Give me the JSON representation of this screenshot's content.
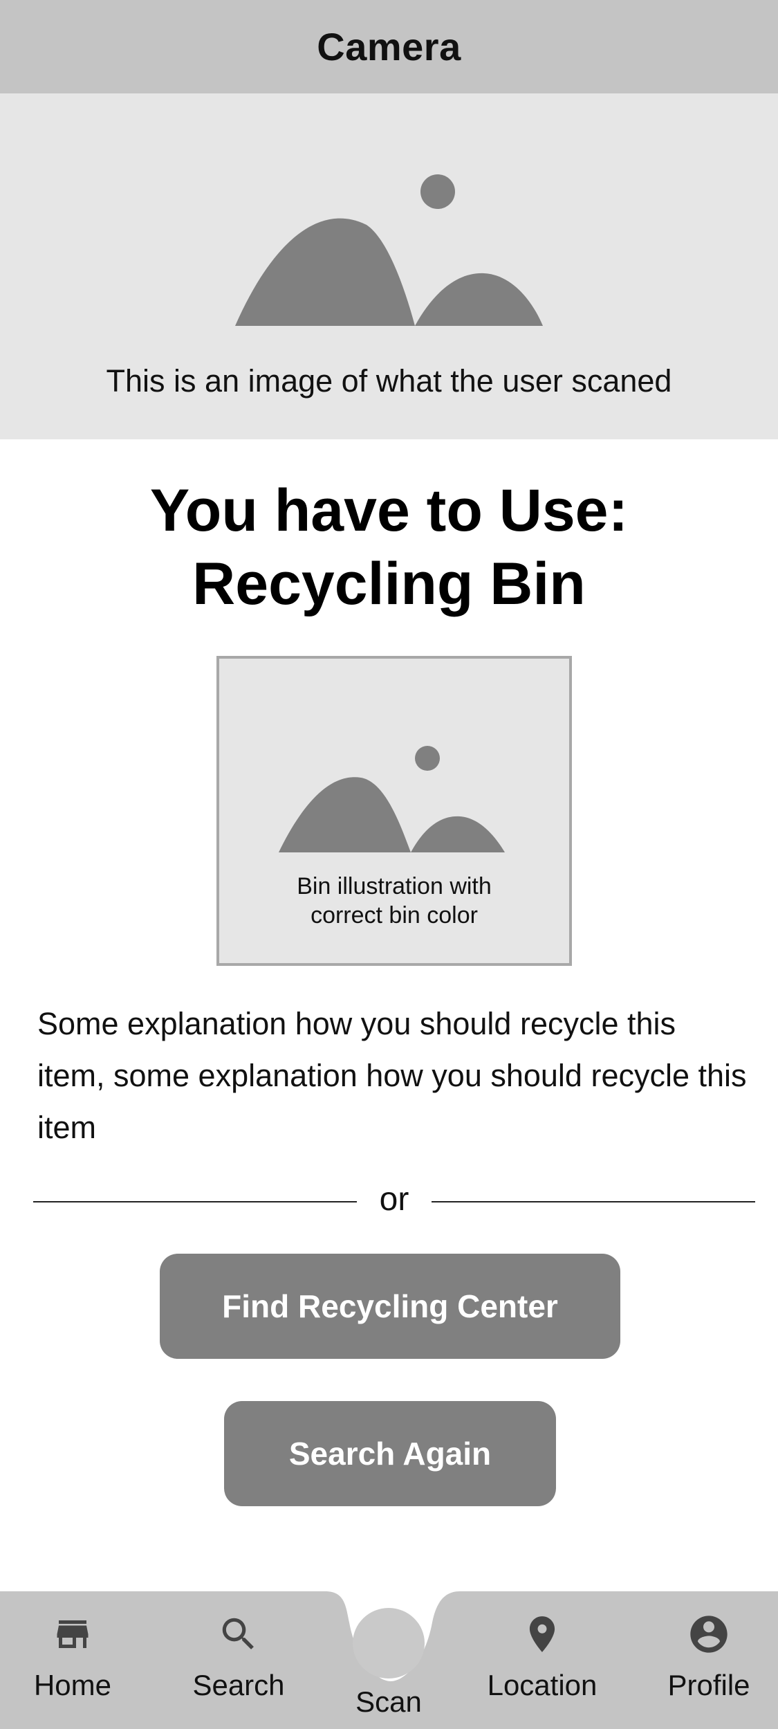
{
  "header": {
    "title": "Camera"
  },
  "scan": {
    "caption": "This is an image of what the user scaned",
    "image_icon": "image-placeholder-icon"
  },
  "result": {
    "heading_line1": "You have to Use:",
    "heading_line2": "Recycling Bin"
  },
  "bin": {
    "caption_line1": "Bin illustration with",
    "caption_line2": "correct bin color",
    "image_icon": "image-placeholder-icon"
  },
  "explanation": {
    "text": "Some explanation how you should recycle this item, some explanation how you should recycle this item"
  },
  "divider": {
    "label": "or"
  },
  "buttons": {
    "find_center": "Find Recycling Center",
    "search_again": "Search Again"
  },
  "nav": {
    "items": [
      {
        "label": "Home",
        "icon": "store-icon"
      },
      {
        "label": "Search",
        "icon": "search-icon"
      },
      {
        "label": "Scan",
        "icon": "scan-circle-icon"
      },
      {
        "label": "Location",
        "icon": "location-pin-icon"
      },
      {
        "label": "Profile",
        "icon": "profile-icon"
      }
    ]
  },
  "colors": {
    "header_bg": "#c4c4c4",
    "placeholder_bg": "#e6e6e6",
    "placeholder_shape": "#808080",
    "button_bg": "#808080",
    "nav_bg": "#c4c4c4"
  }
}
